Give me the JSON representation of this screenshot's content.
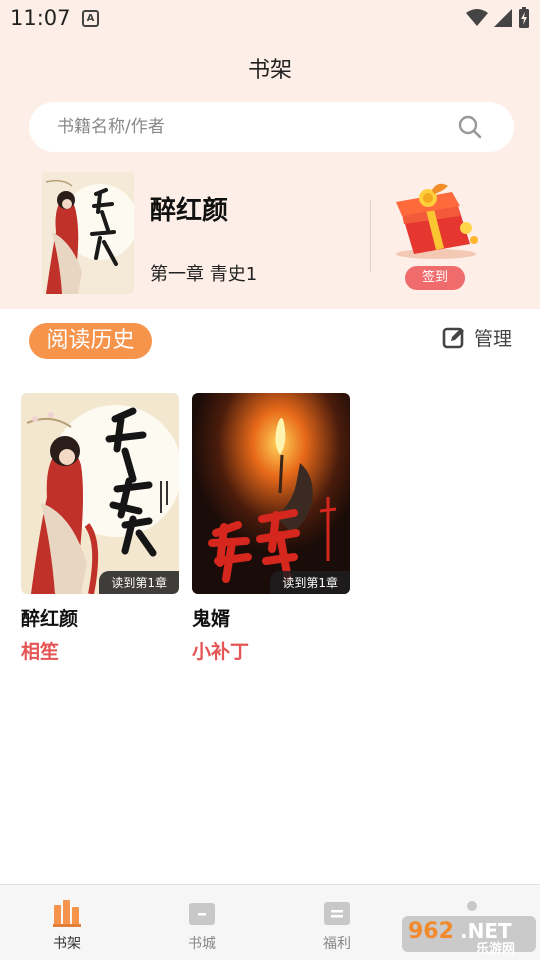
{
  "status": {
    "time": "11:07",
    "notification_badge": "A"
  },
  "page_title": "书架",
  "search": {
    "placeholder": "书籍名称/作者"
  },
  "current_reading": {
    "title": "醉红颜",
    "chapter": "第一章 青史1",
    "checkin_label": "签到"
  },
  "history": {
    "tag": "阅读历史",
    "manage_label": "管理",
    "books": [
      {
        "title": "醉红颜",
        "author": "相笙",
        "progress": "读到第1章",
        "cover_text": "醉红颜"
      },
      {
        "title": "鬼婿",
        "author": "小补丁",
        "progress": "读到第1章",
        "cover_text": "鬼婿"
      }
    ]
  },
  "nav": [
    {
      "label": "书架",
      "icon": "bookshelf-icon",
      "active": true
    },
    {
      "label": "书城",
      "icon": "bookstore-icon",
      "active": false
    },
    {
      "label": "福利",
      "icon": "welfare-icon",
      "active": false
    }
  ],
  "watermark": {
    "text": "962.NET",
    "subtext": "乐游网"
  },
  "colors": {
    "accent": "#f7944c",
    "author": "#e65555",
    "header_bg": "#fdefe7"
  }
}
